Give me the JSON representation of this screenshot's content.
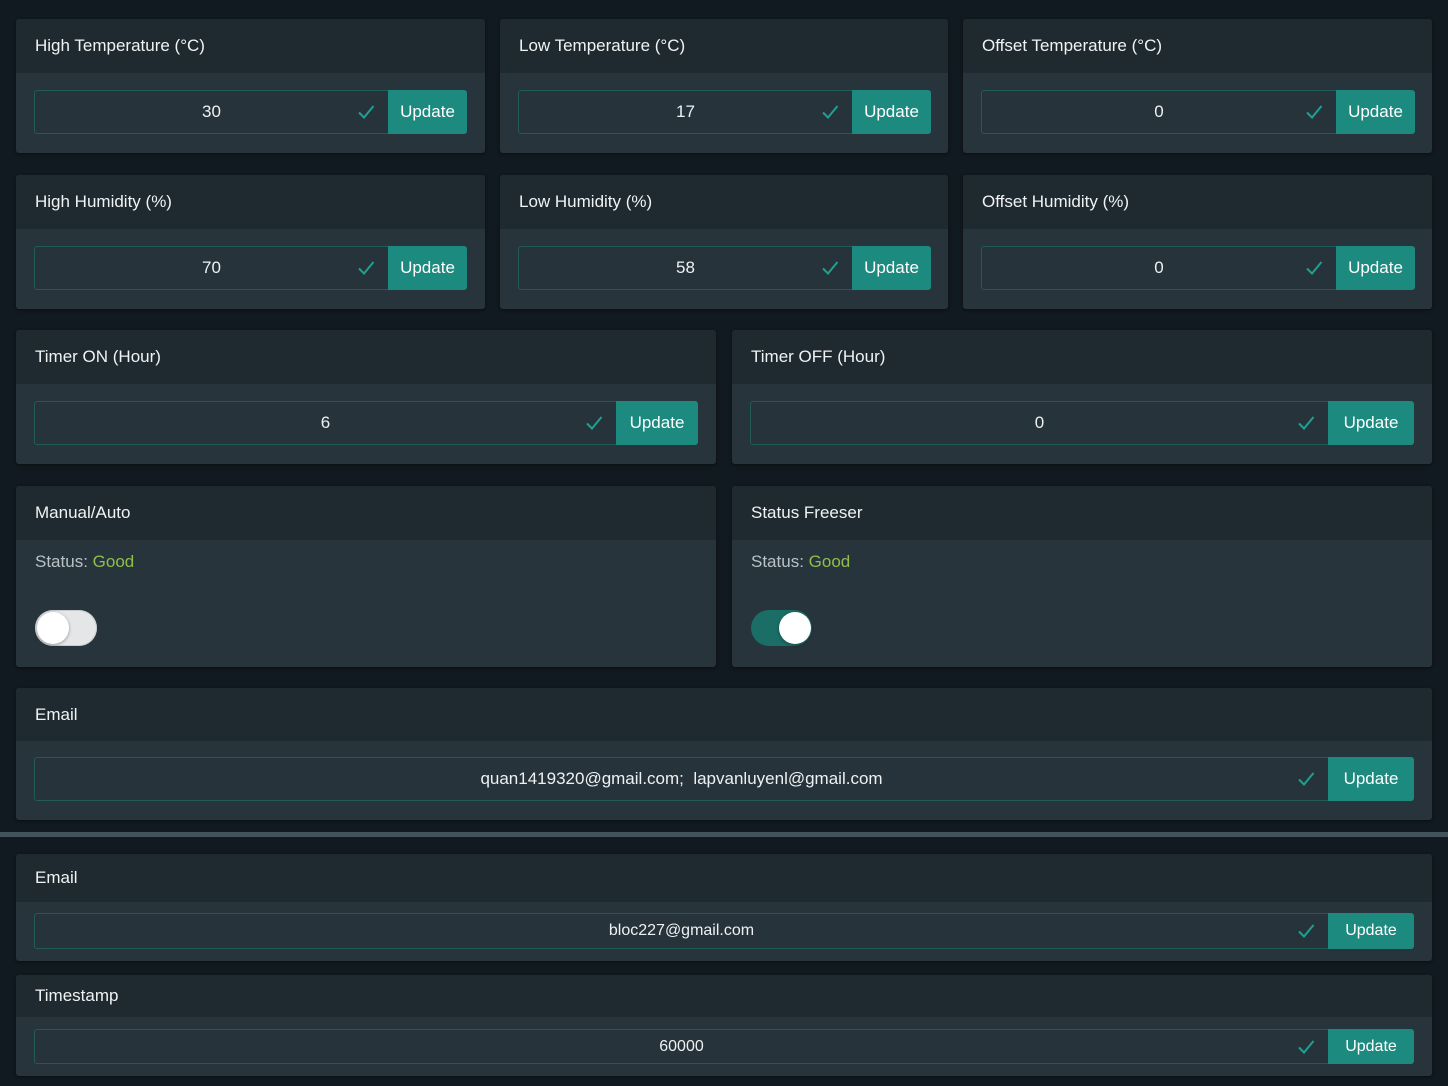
{
  "colors": {
    "page_background": "#111a20",
    "card_body": "#27343c",
    "card_header": "#1f2930",
    "accent_button": "#1d8a80",
    "input_border": "#215b58",
    "status_good": "#8fbf4a"
  },
  "icons": {
    "confirm": "check-icon"
  },
  "update_label": "Update",
  "high_temperature": {
    "title": "High Temperature (°C)",
    "value": "30"
  },
  "low_temperature": {
    "title": "Low Temperature (°C)",
    "value": "17"
  },
  "offset_temperature": {
    "title": "Offset Temperature (°C)",
    "value": "0"
  },
  "high_humidity": {
    "title": "High Humidity (%)",
    "value": "70"
  },
  "low_humidity": {
    "title": "Low Humidity (%)",
    "value": "58"
  },
  "offset_humidity": {
    "title": "Offset Humidity (%)",
    "value": "0"
  },
  "timer_on": {
    "title": "Timer ON (Hour)",
    "value": "6"
  },
  "timer_off": {
    "title": "Timer OFF (Hour)",
    "value": "0"
  },
  "manual_auto": {
    "title": "Manual/Auto",
    "status_label": "Status:",
    "status_value": "Good",
    "switch_on": false
  },
  "status_freeser": {
    "title": "Status Freeser",
    "status_label": "Status:",
    "status_value": "Good",
    "switch_on": true
  },
  "email_primary": {
    "title": "Email",
    "value": "quan1419320@gmail.com;  lapvanluyenl@gmail.com"
  },
  "email_secondary": {
    "title": "Email",
    "value": "bloc227@gmail.com"
  },
  "timestamp": {
    "title": "Timestamp",
    "value": "60000"
  }
}
